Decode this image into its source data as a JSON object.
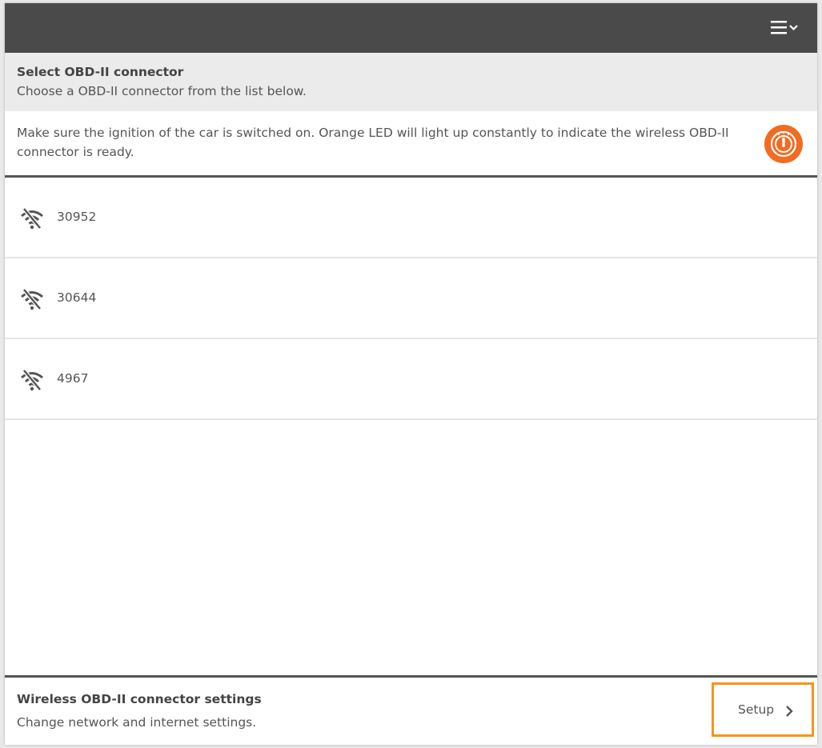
{
  "header": {
    "title": "Select OBD-II connector",
    "subtitle": "Choose a OBD-II connector from the list below."
  },
  "notice": {
    "text": "Make sure the ignition of the car is switched on. Orange LED will light up constantly to indicate the wireless OBD-II connector is ready.",
    "icon": "ignition-icon"
  },
  "connectors": [
    {
      "label": "30952",
      "icon": "wifi-off-icon"
    },
    {
      "label": "30644",
      "icon": "wifi-off-icon"
    },
    {
      "label": "4967",
      "icon": "wifi-off-icon"
    }
  ],
  "footer": {
    "title": "Wireless OBD-II connector settings",
    "subtitle": "Change network and internet settings.",
    "setup_label": "Setup"
  },
  "colors": {
    "topbar": "#4a4a4a",
    "accent_orange": "#f26b21",
    "highlight_border": "#f7941d"
  }
}
